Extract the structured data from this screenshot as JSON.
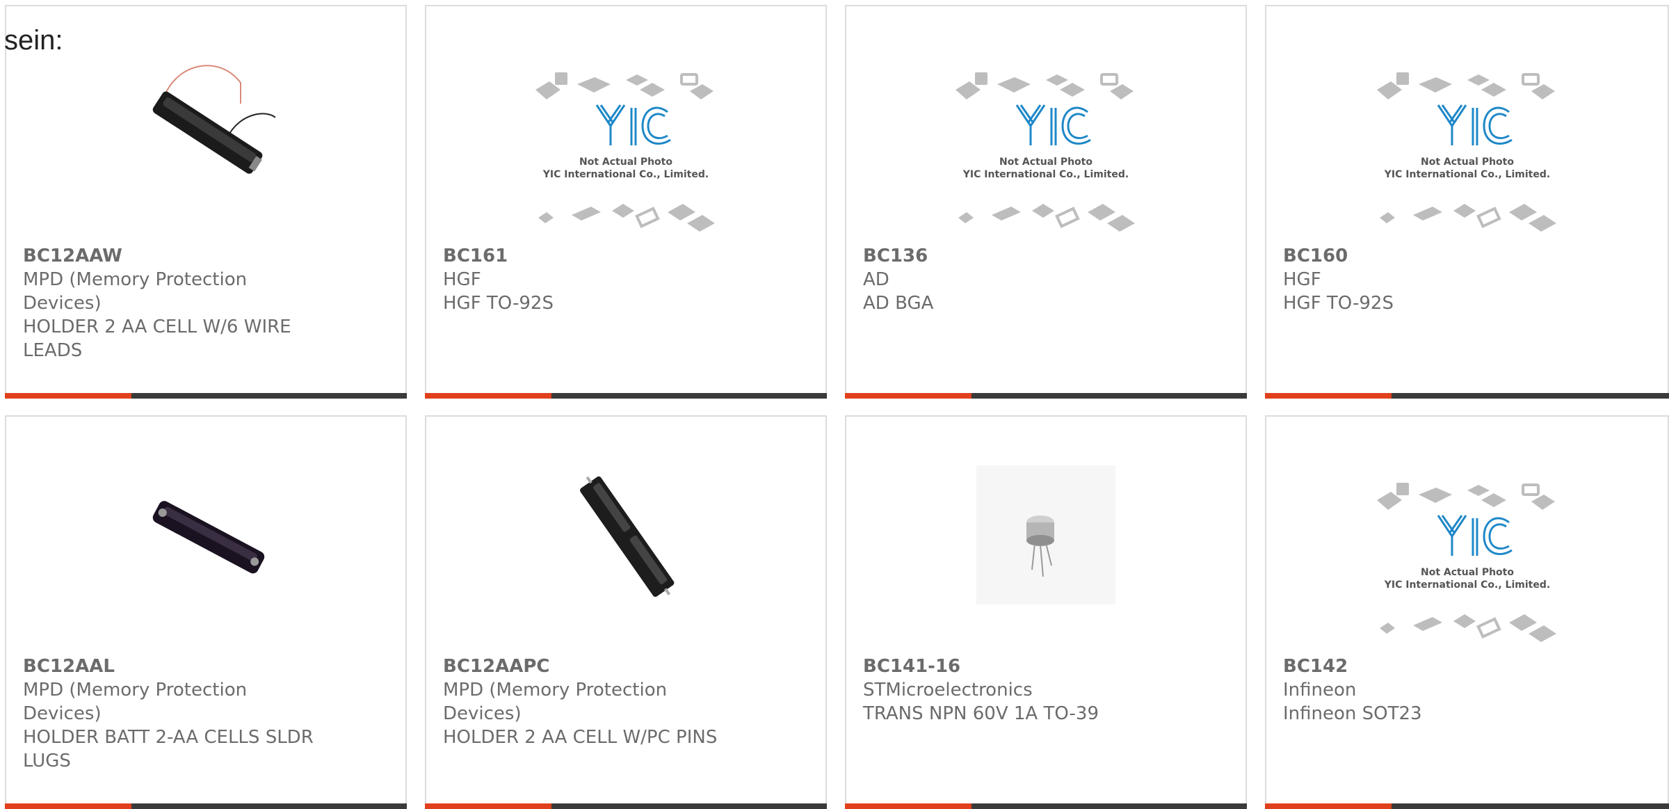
{
  "page": {
    "intro_text": "sein:"
  },
  "colors": {
    "accent_bar": "#e0401c",
    "bar": "#3a3a3a",
    "border": "#dcdcdc",
    "text": "#6b6b6b"
  },
  "placeholder_image": {
    "line1": "Not Actual Photo",
    "line2": "YIC International Co., Limited.",
    "logo_text": "YIC"
  },
  "products": [
    {
      "part_number": "BC12AAW",
      "manufacturer": "MPD (Memory Protection Devices)",
      "description": "HOLDER 2 AA CELL W/6 WIRE LEADS",
      "image": "battery-holder-wire-photo"
    },
    {
      "part_number": "BC161",
      "manufacturer": "HGF",
      "description": "HGF TO-92S",
      "image": "not-actual-photo"
    },
    {
      "part_number": "BC136",
      "manufacturer": "AD",
      "description": "AD BGA",
      "image": "not-actual-photo"
    },
    {
      "part_number": "BC160",
      "manufacturer": "HGF",
      "description": "HGF TO-92S",
      "image": "not-actual-photo"
    },
    {
      "part_number": "BC12AAL",
      "manufacturer": "MPD (Memory Protection Devices)",
      "description": "HOLDER BATT 2-AA CELLS SLDR LUGS",
      "image": "battery-holder-lugs-photo"
    },
    {
      "part_number": "BC12AAPC",
      "manufacturer": "MPD (Memory Protection Devices)",
      "description": "HOLDER 2 AA CELL W/PC PINS",
      "image": "battery-holder-pins-photo"
    },
    {
      "part_number": "BC141-16",
      "manufacturer": "STMicroelectronics",
      "description": "TRANS NPN 60V 1A TO-39",
      "image": "to39-transistor-photo"
    },
    {
      "part_number": "BC142",
      "manufacturer": "Infineon",
      "description": "Infineon SOT23",
      "image": "not-actual-photo"
    }
  ]
}
